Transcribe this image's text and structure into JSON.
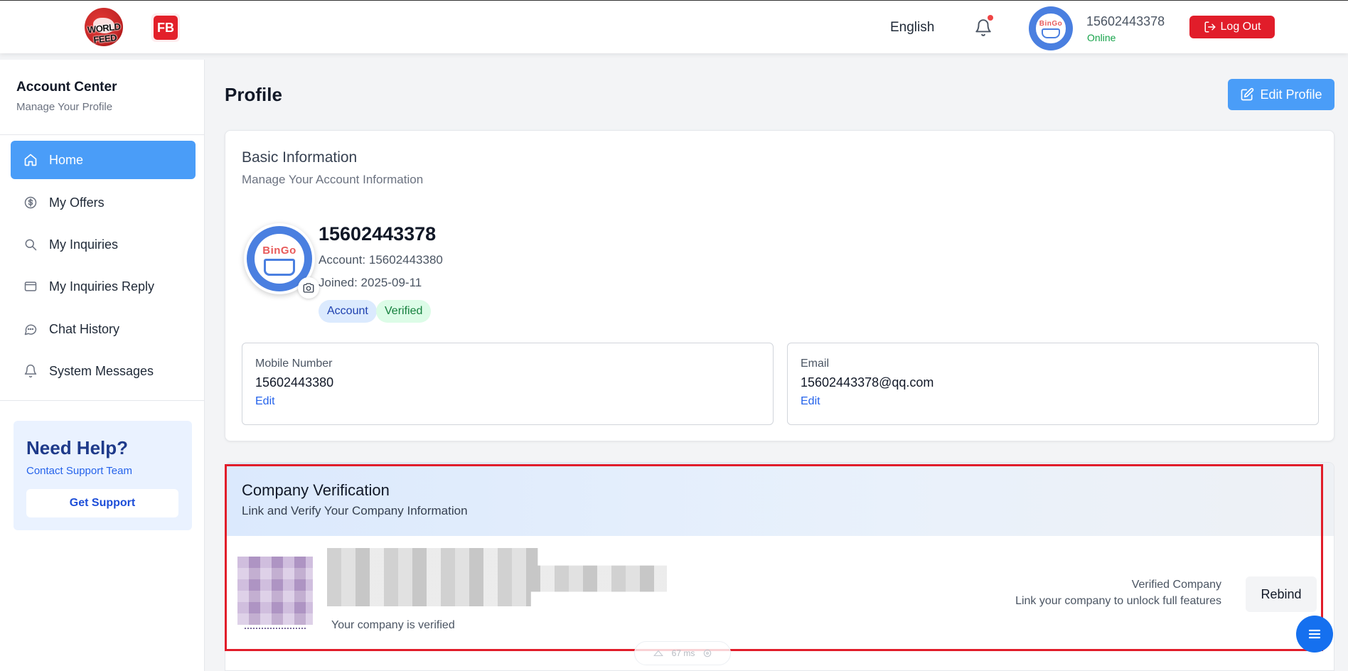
{
  "header": {
    "logo_text": "WORLD FEED",
    "fb_logo": "FB",
    "language": "English",
    "user_name": "15602443378",
    "user_status": "Online",
    "logout_label": "Log Out",
    "icons": {
      "bell": "bell-icon",
      "logout": "logout-icon"
    },
    "accent": "#e11d2a"
  },
  "sidebar": {
    "title": "Account Center",
    "subtitle": "Manage Your Profile",
    "items": [
      {
        "label": "Home",
        "icon": "home-icon",
        "active": true
      },
      {
        "label": "My Offers",
        "icon": "dollar-circle-icon",
        "active": false
      },
      {
        "label": "My Inquiries",
        "icon": "search-icon",
        "active": false
      },
      {
        "label": "My Inquiries Reply",
        "icon": "card-icon",
        "active": false
      },
      {
        "label": "Chat History",
        "icon": "chat-icon",
        "active": false
      },
      {
        "label": "System Messages",
        "icon": "bell-icon",
        "active": false
      }
    ],
    "help": {
      "title": "Need Help?",
      "subtitle": "Contact Support Team",
      "button_label": "Get Support"
    }
  },
  "main": {
    "page_title": "Profile",
    "edit_profile_label": "Edit Profile",
    "basic": {
      "title": "Basic Information",
      "subtitle": "Manage Your Account Information",
      "avatar_text": "BinGo",
      "name": "15602443378",
      "account": "Account: 15602443380",
      "joined": "Joined: 2025-09-11",
      "badges": [
        "Account",
        "Verified"
      ],
      "mobile": {
        "label": "Mobile Number",
        "value": "15602443380",
        "edit_label": "Edit"
      },
      "email": {
        "label": "Email",
        "value": "15602443378@qq.com",
        "edit_label": "Edit"
      }
    },
    "company": {
      "title": "Company Verification",
      "subtitle": "Link and Verify Your Company Information",
      "status_text": "Your company is verified",
      "right_title": "Verified Company",
      "right_subtitle": "Link your company to unlock full features",
      "rebind_label": "Rebind"
    }
  },
  "overlay": {
    "fps_text": "67 ms"
  },
  "colors": {
    "primary": "#4a9df8",
    "danger": "#e11d2a",
    "success": "#16a34a"
  }
}
